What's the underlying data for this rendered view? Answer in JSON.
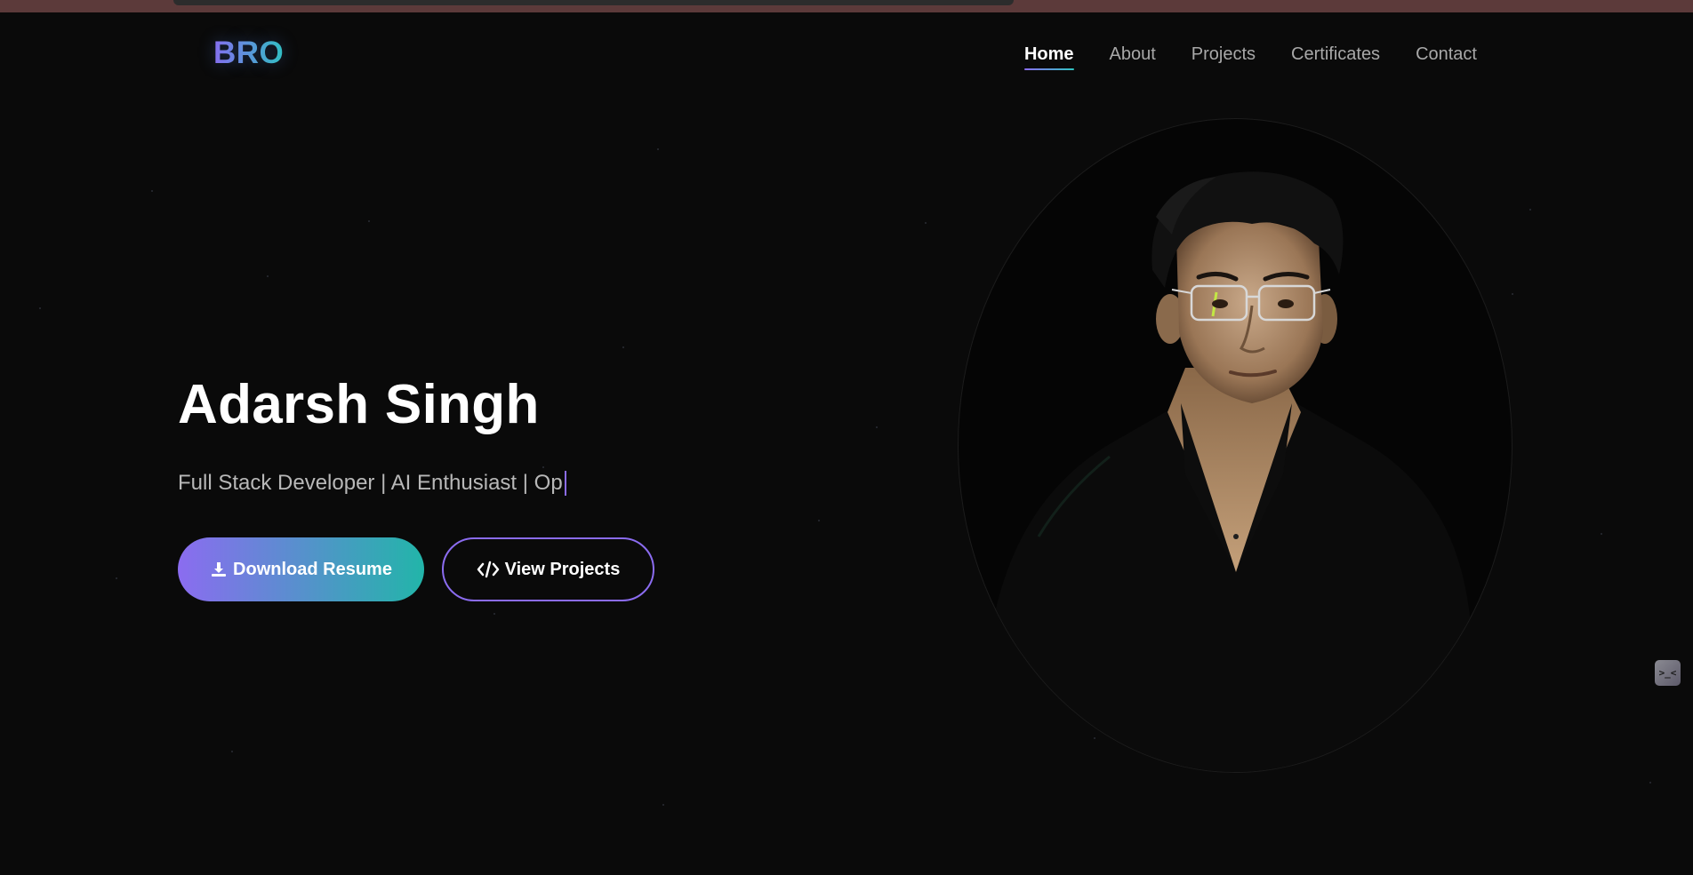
{
  "brand": {
    "logo": "BRO"
  },
  "nav": {
    "items": [
      {
        "label": "Home",
        "active": true
      },
      {
        "label": "About",
        "active": false
      },
      {
        "label": "Projects",
        "active": false
      },
      {
        "label": "Certificates",
        "active": false
      },
      {
        "label": "Contact",
        "active": false
      }
    ]
  },
  "hero": {
    "name": "Adarsh Singh",
    "subtitle": "Full Stack Developer | AI Enthusiast | Op",
    "buttons": {
      "download": {
        "label": "Download Resume",
        "icon": "download-icon"
      },
      "projects": {
        "label": "View Projects",
        "icon": "code-icon"
      }
    }
  },
  "widget": {
    "glyph": ">_<"
  },
  "colors": {
    "background": "#0a0a0a",
    "accent_purple": "#8b6cf0",
    "accent_teal": "#2ec4c0",
    "top_strip": "#5c3a3a"
  }
}
